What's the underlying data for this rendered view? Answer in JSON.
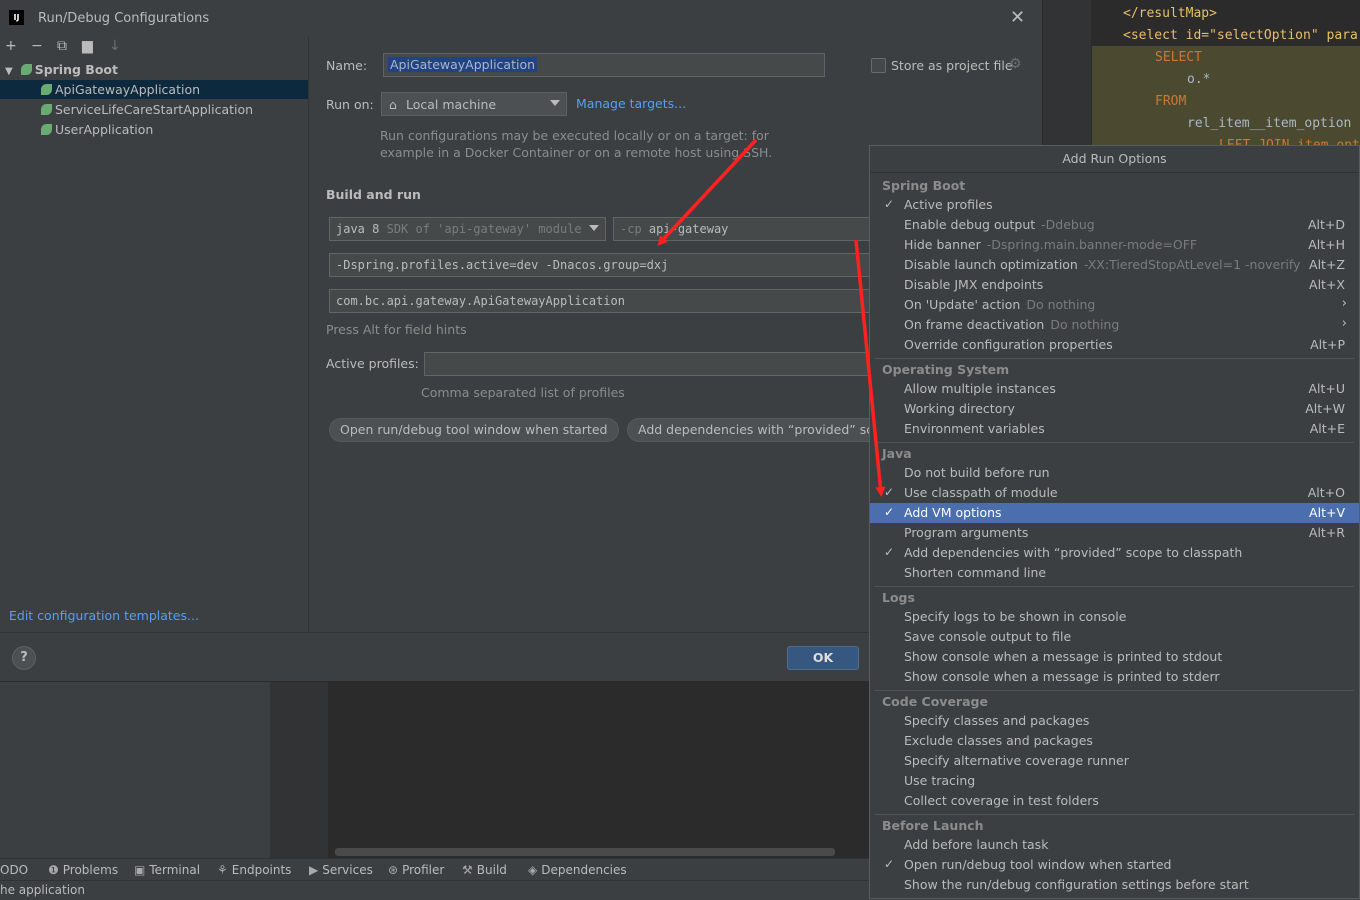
{
  "status": {
    "message": "he application"
  },
  "bottom_tabs": [
    {
      "label": "ODO",
      "icon": ""
    },
    {
      "label": "Problems",
      "icon": "problems-icon"
    },
    {
      "label": "Terminal",
      "icon": "terminal-icon"
    },
    {
      "label": "Endpoints",
      "icon": "endpoints-icon"
    },
    {
      "label": "Services",
      "icon": "services-icon"
    },
    {
      "label": "Profiler",
      "icon": "profiler-icon"
    },
    {
      "label": "Build",
      "icon": "build-icon"
    },
    {
      "label": "Dependencies",
      "icon": "dependencies-icon"
    }
  ],
  "editor": {
    "lines": [
      "</resultMap>",
      "<select id=\"selectOption\" para",
      "SELECT",
      "o.*",
      "FROM",
      "rel_item__item_option",
      "LEFT JOIN item_opt"
    ]
  },
  "dialog": {
    "title": "Run/Debug Configurations",
    "logo": "IJ",
    "toolbar": {
      "add": "+",
      "remove": "−",
      "copy": "⧉",
      "folder": "▾",
      "sort": "↓"
    },
    "tree": {
      "group": "Spring Boot",
      "items": [
        "ApiGatewayApplication",
        "ServiceLifeCareStartApplication",
        "UserApplication"
      ]
    },
    "edit_templates": "Edit configuration templates...",
    "help": "?",
    "ok": "OK",
    "name_label": "Name:",
    "name_value": "ApiGatewayApplication",
    "store_label": "Store as project file",
    "run_on_label": "Run on:",
    "run_on_value": "Local machine",
    "manage_targets": "Manage targets...",
    "run_on_hint_1": "Run configurations may be executed locally or on a target: for",
    "run_on_hint_2": "example in a Docker Container or on a remote host using SSH.",
    "build_and_run": "Build and run",
    "jdk_value": "java 8",
    "jdk_hint": "SDK of 'api-gateway' module",
    "cp_flag": "-cp",
    "cp_value": "api-gateway",
    "vm_options": "-Dspring.profiles.active=dev -Dnacos.group=dxj",
    "main_class": "com.bc.api.gateway.ApiGatewayApplication",
    "alt_hint": "Press Alt for field hints",
    "active_profiles_label": "Active profiles:",
    "active_profiles_value": "",
    "profiles_hint": "Comma separated list of profiles",
    "chips": [
      "Open run/debug tool window when started",
      "Add dependencies with “provided” scope"
    ]
  },
  "popup": {
    "title": "Add Run Options",
    "groups": [
      {
        "name": "Spring Boot",
        "items": [
          {
            "label": "Active profiles",
            "desc": "",
            "shortcut": "",
            "checked": true,
            "submenu": false
          },
          {
            "label": "Enable debug output",
            "desc": "-Ddebug",
            "shortcut": "Alt+D",
            "checked": false,
            "submenu": false
          },
          {
            "label": "Hide banner",
            "desc": "-Dspring.main.banner-mode=OFF",
            "shortcut": "Alt+H",
            "checked": false,
            "submenu": false
          },
          {
            "label": "Disable launch optimization",
            "desc": "-XX:TieredStopAtLevel=1 -noverify",
            "shortcut": "Alt+Z",
            "checked": false,
            "submenu": false
          },
          {
            "label": "Disable JMX endpoints",
            "desc": "",
            "shortcut": "Alt+X",
            "checked": false,
            "submenu": false
          },
          {
            "label": "On 'Update' action",
            "desc": "Do nothing",
            "shortcut": "",
            "checked": false,
            "submenu": true
          },
          {
            "label": "On frame deactivation",
            "desc": "Do nothing",
            "shortcut": "",
            "checked": false,
            "submenu": true
          },
          {
            "label": "Override configuration properties",
            "desc": "",
            "shortcut": "Alt+P",
            "checked": false,
            "submenu": false
          }
        ]
      },
      {
        "name": "Operating System",
        "items": [
          {
            "label": "Allow multiple instances",
            "desc": "",
            "shortcut": "Alt+U",
            "checked": false,
            "submenu": false
          },
          {
            "label": "Working directory",
            "desc": "",
            "shortcut": "Alt+W",
            "checked": false,
            "submenu": false
          },
          {
            "label": "Environment variables",
            "desc": "",
            "shortcut": "Alt+E",
            "checked": false,
            "submenu": false
          }
        ]
      },
      {
        "name": "Java",
        "items": [
          {
            "label": "Do not build before run",
            "desc": "",
            "shortcut": "",
            "checked": false,
            "submenu": false
          },
          {
            "label": "Use classpath of module",
            "desc": "",
            "shortcut": "Alt+O",
            "checked": true,
            "submenu": false
          },
          {
            "label": "Add VM options",
            "desc": "",
            "shortcut": "Alt+V",
            "checked": true,
            "submenu": false,
            "selected": true
          },
          {
            "label": "Program arguments",
            "desc": "",
            "shortcut": "Alt+R",
            "checked": false,
            "submenu": false
          },
          {
            "label": "Add dependencies with “provided” scope to classpath",
            "desc": "",
            "shortcut": "",
            "checked": true,
            "submenu": false
          },
          {
            "label": "Shorten command line",
            "desc": "",
            "shortcut": "",
            "checked": false,
            "submenu": false
          }
        ]
      },
      {
        "name": "Logs",
        "items": [
          {
            "label": "Specify logs to be shown in console",
            "desc": "",
            "shortcut": "",
            "checked": false,
            "submenu": false
          },
          {
            "label": "Save console output to file",
            "desc": "",
            "shortcut": "",
            "checked": false,
            "submenu": false
          },
          {
            "label": "Show console when a message is printed to stdout",
            "desc": "",
            "shortcut": "",
            "checked": false,
            "submenu": false
          },
          {
            "label": "Show console when a message is printed to stderr",
            "desc": "",
            "shortcut": "",
            "checked": false,
            "submenu": false
          }
        ]
      },
      {
        "name": "Code Coverage",
        "items": [
          {
            "label": "Specify classes and packages",
            "desc": "",
            "shortcut": "",
            "checked": false,
            "submenu": false
          },
          {
            "label": "Exclude classes and packages",
            "desc": "",
            "shortcut": "",
            "checked": false,
            "submenu": false
          },
          {
            "label": "Specify alternative coverage runner",
            "desc": "",
            "shortcut": "",
            "checked": false,
            "submenu": false
          },
          {
            "label": "Use tracing",
            "desc": "",
            "shortcut": "",
            "checked": false,
            "submenu": false
          },
          {
            "label": "Collect coverage in test folders",
            "desc": "",
            "shortcut": "",
            "checked": false,
            "submenu": false
          }
        ]
      },
      {
        "name": "Before Launch",
        "items": [
          {
            "label": "Add before launch task",
            "desc": "",
            "shortcut": "",
            "checked": false,
            "submenu": false
          },
          {
            "label": "Open run/debug tool window when started",
            "desc": "",
            "shortcut": "",
            "checked": true,
            "submenu": false
          },
          {
            "label": "Show the run/debug configuration settings before start",
            "desc": "",
            "shortcut": "",
            "checked": false,
            "submenu": false
          }
        ]
      }
    ]
  },
  "colors": {
    "accent": "#4b6eaf",
    "link": "#589df6",
    "annotation": "#ff2020"
  }
}
